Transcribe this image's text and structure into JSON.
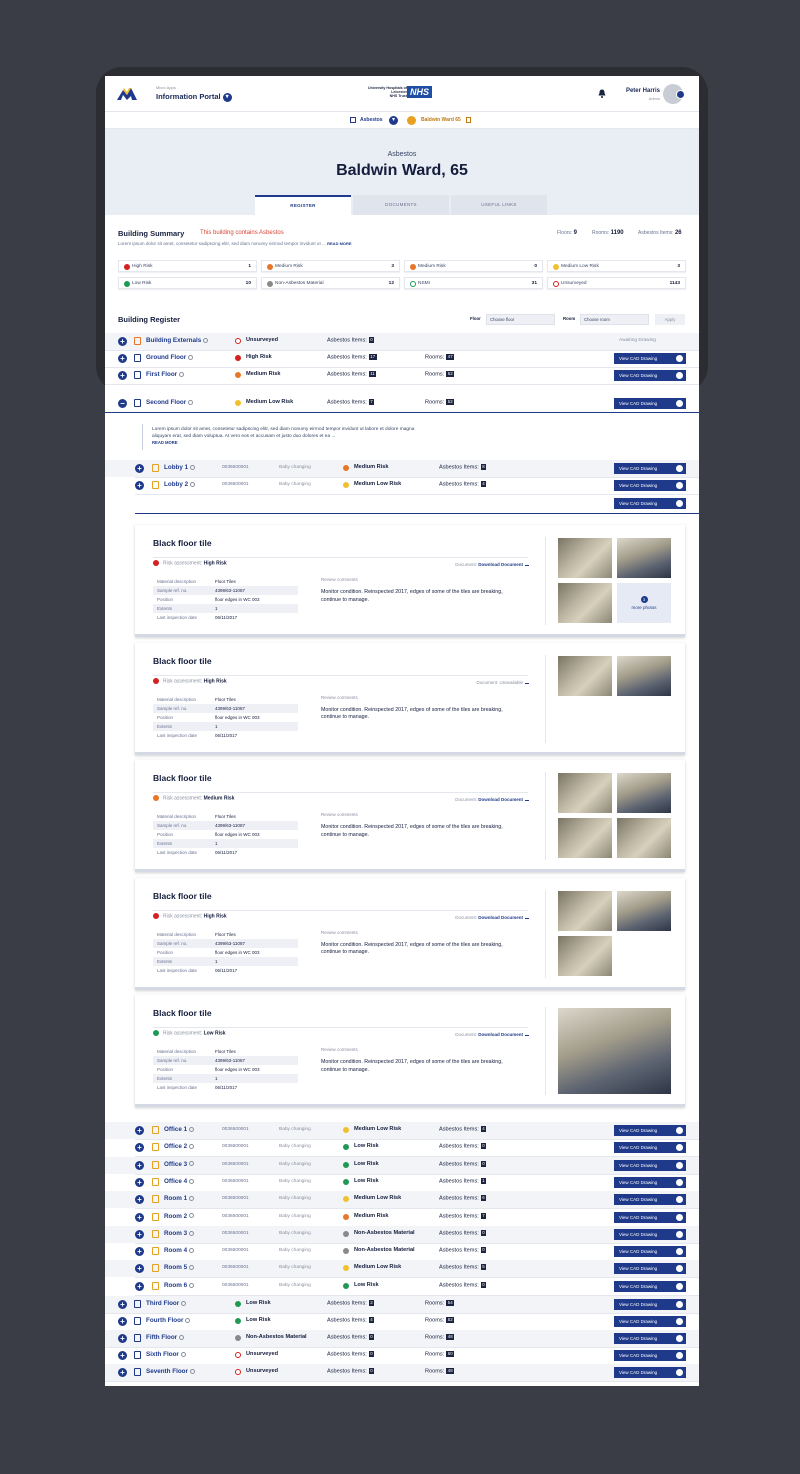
{
  "header": {
    "micro_label": "Micro Apps",
    "portal_name": "Information Portal",
    "nhs_trust": "University Hospitals of Leicester",
    "nhs_trust_sub": "NHS Trust",
    "nhs_logo": "NHS",
    "user_name": "Peter Harris",
    "user_role": "Admin"
  },
  "subbar": {
    "section": "Asbestos",
    "location": "Baldwin Ward 65"
  },
  "hero": {
    "subtitle": "Asbestos",
    "title": "Baldwin Ward, 65"
  },
  "tabs": [
    {
      "label": "REGISTER"
    },
    {
      "label": "DOCUMENTS"
    },
    {
      "label": "USEFUL LINKS"
    }
  ],
  "summary": {
    "title": "Building Summary",
    "warning": "This building contains Asbestos",
    "lorem": "Lorem ipsum dolor sit amet, consetetur sadipscing elitr, sed diam nonumy eirmod tempor invidunt ut ...",
    "read_more": "READ MORE",
    "floors_label": "Floors:",
    "floors": "9",
    "rooms_label": "Rooms:",
    "rooms": "1190",
    "items_label": "Asbestos Items:",
    "items": "26"
  },
  "stats": [
    {
      "label": "High Risk",
      "value": "1",
      "color": "#d42020"
    },
    {
      "label": "Medium Risk",
      "value": "3",
      "color": "#e87628"
    },
    {
      "label": "Medium Risk",
      "value": "0",
      "color": "#e87628"
    },
    {
      "label": "Medium Low Risk",
      "value": "3",
      "color": "#f0c030"
    },
    {
      "label": "Low Risk",
      "value": "10",
      "color": "#1f9a55"
    },
    {
      "label": "Non-Asbestos Material",
      "value": "12",
      "color": "#8a8a8a"
    },
    {
      "label": "NSMI",
      "value": "31",
      "color": "#1f9a55"
    },
    {
      "label": "Unsurveyed",
      "value": "1143",
      "color": "#d42020"
    }
  ],
  "register": {
    "title": "Building Register",
    "floor_label": "Floor",
    "floor_placeholder": "Choose floor",
    "room_label": "Room",
    "room_placeholder": "Choose room",
    "apply": "Apply",
    "cad_label": "View CAD Drawing",
    "items_label": "Asbestos Items:",
    "rooms_label": "Rooms:",
    "awaiting": "Awaiting Drawing"
  },
  "floors_top": [
    {
      "name": "Building Externals",
      "risk": "Unsurveyed",
      "items": "0",
      "rooms": ""
    },
    {
      "name": "Ground Floor",
      "risk": "High Risk",
      "items": "17",
      "rooms": "47"
    },
    {
      "name": "First Floor",
      "risk": "Medium Risk",
      "items": "11",
      "rooms": "52"
    },
    {
      "name": "Second Floor",
      "risk": "Medium Low Risk",
      "items": "7",
      "rooms": "52"
    }
  ],
  "second_floor_desc": {
    "text": "Lorem ipsum dolor sit amet, consetetur sadipscing elitr, sed diam nonumy eirmod tempor invidunt ut labore et dolore magna aliquyam erat, sed diam voluptua. At vero eos et accusam et justo duo dolores et ea ...",
    "read_more": "READ MORE"
  },
  "lobbies": [
    {
      "name": "Lobby 1",
      "code": "0036500001",
      "type": "Baby changing",
      "risk": "Medium Risk",
      "items": "8"
    },
    {
      "name": "Lobby 2",
      "code": "0036500001",
      "type": "Baby changing",
      "risk": "Medium Low Risk",
      "items": "4"
    }
  ],
  "cards": [
    {
      "title": "Black floor tile",
      "risk_label": "Risk assessment:",
      "risk": "High Risk",
      "doc_label": "Document:",
      "doc": "Download Document",
      "material_label": "Material description",
      "material": "Floor Tiles",
      "sample_label": "Sample ref. no.",
      "sample": "4399/63-11087",
      "position_label": "Position",
      "position": "floor edges in WC 003",
      "extents_label": "Extents",
      "extents": "1",
      "inspection_label": "Last inspection date",
      "inspection": "06/11/2017",
      "review_label": "Review comments",
      "review": "Monitor condition. Reinspected 2017, edges of some of the tiles are breaking, continue to manage.",
      "more": "more photos",
      "more_count": "3"
    },
    {
      "title": "Black floor tile",
      "risk_label": "Risk assessment:",
      "risk": "High Risk",
      "doc_label": "Document:",
      "doc": "Unavailable",
      "material_label": "Material description",
      "material": "Floor Tiles",
      "sample_label": "Sample ref. no.",
      "sample": "4399/63-11087",
      "position_label": "Position",
      "position": "floor edges in WC 003",
      "extents_label": "Extents",
      "extents": "1",
      "inspection_label": "Last inspection date",
      "inspection": "06/11/2017",
      "review_label": "Review comments",
      "review": "Monitor condition. Reinspected 2017, edges of some of the tiles are breaking, continue to manage."
    },
    {
      "title": "Black floor tile",
      "risk_label": "Risk assessment:",
      "risk": "Medium Risk",
      "doc_label": "Document:",
      "doc": "Download Document",
      "material_label": "Material description",
      "material": "Floor Tiles",
      "sample_label": "Sample ref. no.",
      "sample": "4399/63-11087",
      "position_label": "Position",
      "position": "floor edges in WC 003",
      "extents_label": "Extents",
      "extents": "1",
      "inspection_label": "Last inspection date",
      "inspection": "06/11/2017",
      "review_label": "Review comments",
      "review": "Monitor condition. Reinspected 2017, edges of some of the tiles are breaking, continue to manage."
    },
    {
      "title": "Black floor tile",
      "risk_label": "Risk assessment:",
      "risk": "High Risk",
      "doc_label": "Document:",
      "doc": "Download Document",
      "material_label": "Material description",
      "material": "Floor Tiles",
      "sample_label": "Sample ref. no.",
      "sample": "4399/63-11087",
      "position_label": "Position",
      "position": "floor edges in WC 003",
      "extents_label": "Extents",
      "extents": "1",
      "inspection_label": "Last inspection date",
      "inspection": "06/11/2017",
      "review_label": "Review comments",
      "review": "Monitor condition. Reinspected 2017, edges of some of the tiles are breaking, continue to manage."
    },
    {
      "title": "Black floor tile",
      "risk_label": "Risk assessment:",
      "risk": "Low Risk",
      "doc_label": "Document:",
      "doc": "Download Document",
      "material_label": "Material description",
      "material": "Floor Tiles",
      "sample_label": "Sample ref. no.",
      "sample": "4399/63-11087",
      "position_label": "Position",
      "position": "floor edges in WC 003",
      "extents_label": "Extents",
      "extents": "1",
      "inspection_label": "Last inspection date",
      "inspection": "06/11/2017",
      "review_label": "Review comments",
      "review": "Monitor condition. Reinspected 2017, edges of some of the tiles are breaking, continue to manage."
    }
  ],
  "rooms": [
    {
      "name": "Office 1",
      "code": "0036500001",
      "type": "Baby changing",
      "risk": "Medium Low Risk",
      "items": "4"
    },
    {
      "name": "Office 2",
      "code": "0036500001",
      "type": "Baby changing",
      "risk": "Low Risk",
      "items": "0"
    },
    {
      "name": "Office 3",
      "code": "0036500001",
      "type": "Baby changing",
      "risk": "Low Risk",
      "items": "0"
    },
    {
      "name": "Office 4",
      "code": "0036500001",
      "type": "Baby changing",
      "risk": "Low Risk",
      "items": "1"
    },
    {
      "name": "Room 1",
      "code": "0036500001",
      "type": "Baby changing",
      "risk": "Medium Low Risk",
      "items": "6"
    },
    {
      "name": "Room 2",
      "code": "0036500001",
      "type": "Baby changing",
      "risk": "Medium Risk",
      "items": "7"
    },
    {
      "name": "Room 3",
      "code": "0036500001",
      "type": "Baby changing",
      "risk": "Non-Asbestos Material",
      "items": "0"
    },
    {
      "name": "Room 4",
      "code": "0036500001",
      "type": "Baby changing",
      "risk": "Non-Asbestos Material",
      "items": "0"
    },
    {
      "name": "Room 5",
      "code": "0036500001",
      "type": "Baby changing",
      "risk": "Medium Low Risk",
      "items": "5"
    },
    {
      "name": "Room 6",
      "code": "0036500001",
      "type": "Baby changing",
      "risk": "Low Risk",
      "items": "0"
    }
  ],
  "floors_bottom": [
    {
      "name": "Third Floor",
      "risk": "Low Risk",
      "items": "2",
      "rooms": "54"
    },
    {
      "name": "Fourth Floor",
      "risk": "Low Risk",
      "items": "4",
      "rooms": "52"
    },
    {
      "name": "Fifth Floor",
      "risk": "Non-Asbestos Material",
      "items": "0",
      "rooms": "48"
    },
    {
      "name": "Sixth Floor",
      "risk": "Unsurveyed",
      "items": "0",
      "rooms": "60"
    },
    {
      "name": "Seventh Floor",
      "risk": "Unsurveyed",
      "items": "0",
      "rooms": "48"
    }
  ]
}
